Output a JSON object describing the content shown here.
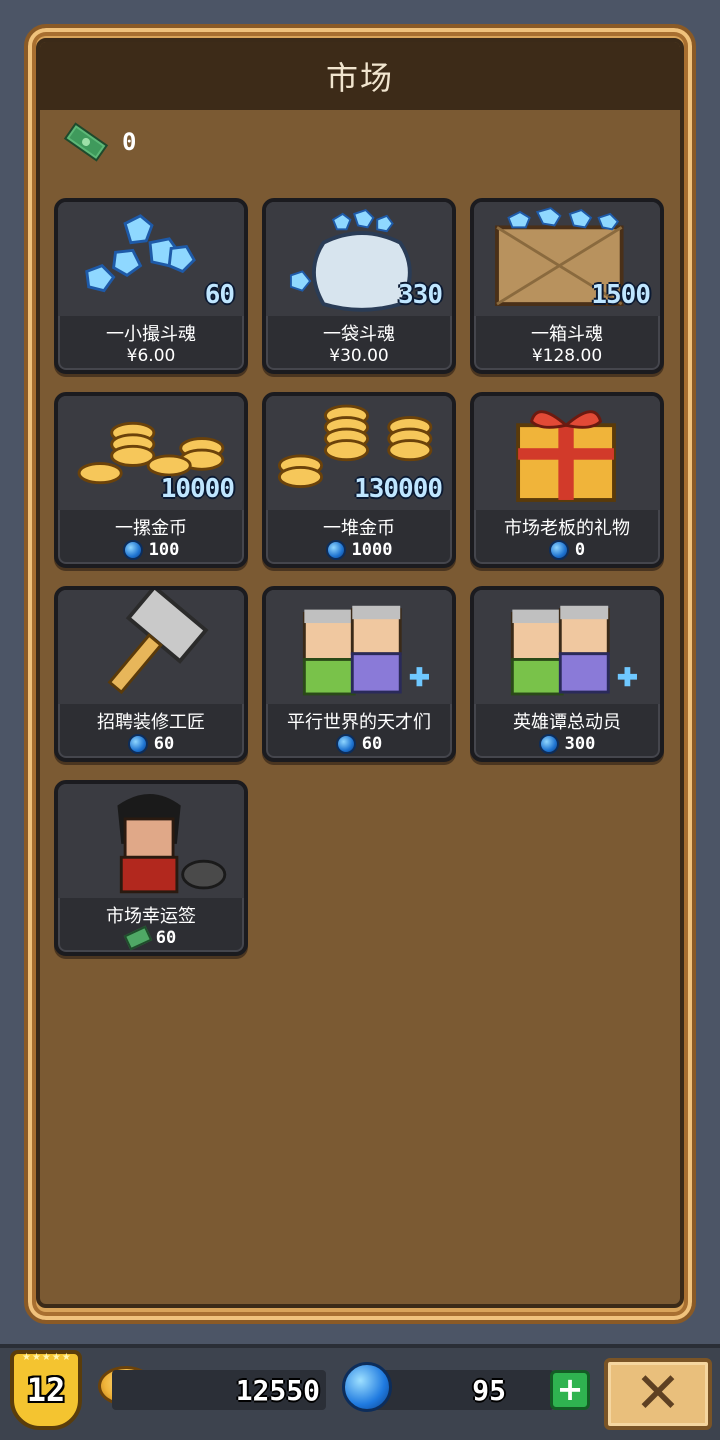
{
  "market": {
    "title": "市场",
    "cash_balance": "0"
  },
  "items": [
    {
      "name": "一小撮斗魂",
      "price": "¥6.00",
      "currency": "rmb",
      "amount": "60"
    },
    {
      "name": "一袋斗魂",
      "price": "¥30.00",
      "currency": "rmb",
      "amount": "330"
    },
    {
      "name": "一箱斗魂",
      "price": "¥128.00",
      "currency": "rmb",
      "amount": "1500"
    },
    {
      "name": "一摞金币",
      "price": "100",
      "currency": "gem",
      "amount": "10000"
    },
    {
      "name": "一堆金币",
      "price": "1000",
      "currency": "gem",
      "amount": "130000"
    },
    {
      "name": "市场老板的礼物",
      "price": "0",
      "currency": "gem",
      "amount": ""
    },
    {
      "name": "招聘装修工匠",
      "price": "60",
      "currency": "gem",
      "amount": ""
    },
    {
      "name": "平行世界的天才们",
      "price": "60",
      "currency": "gem",
      "amount": ""
    },
    {
      "name": "英雄谭总动员",
      "price": "300",
      "currency": "gem",
      "amount": ""
    },
    {
      "name": "市场幸运签",
      "price": "60",
      "currency": "cash",
      "amount": ""
    }
  ],
  "bottom_bar": {
    "level": "12",
    "coins": "12550",
    "gems": "95",
    "plus_label": "+",
    "close_label": "✕"
  },
  "icons": {
    "cash": "cash-icon",
    "gem": "gem-icon",
    "coin": "coin-icon",
    "close": "close-icon",
    "plus": "plus-icon"
  },
  "colors": {
    "panel": "#7b5a33",
    "header": "#3d2b18",
    "card": "#2d2e33",
    "frame": "#d9a45a",
    "gem": "#1f7ae0",
    "coin": "#f0b43a",
    "plus": "#2fb350"
  }
}
